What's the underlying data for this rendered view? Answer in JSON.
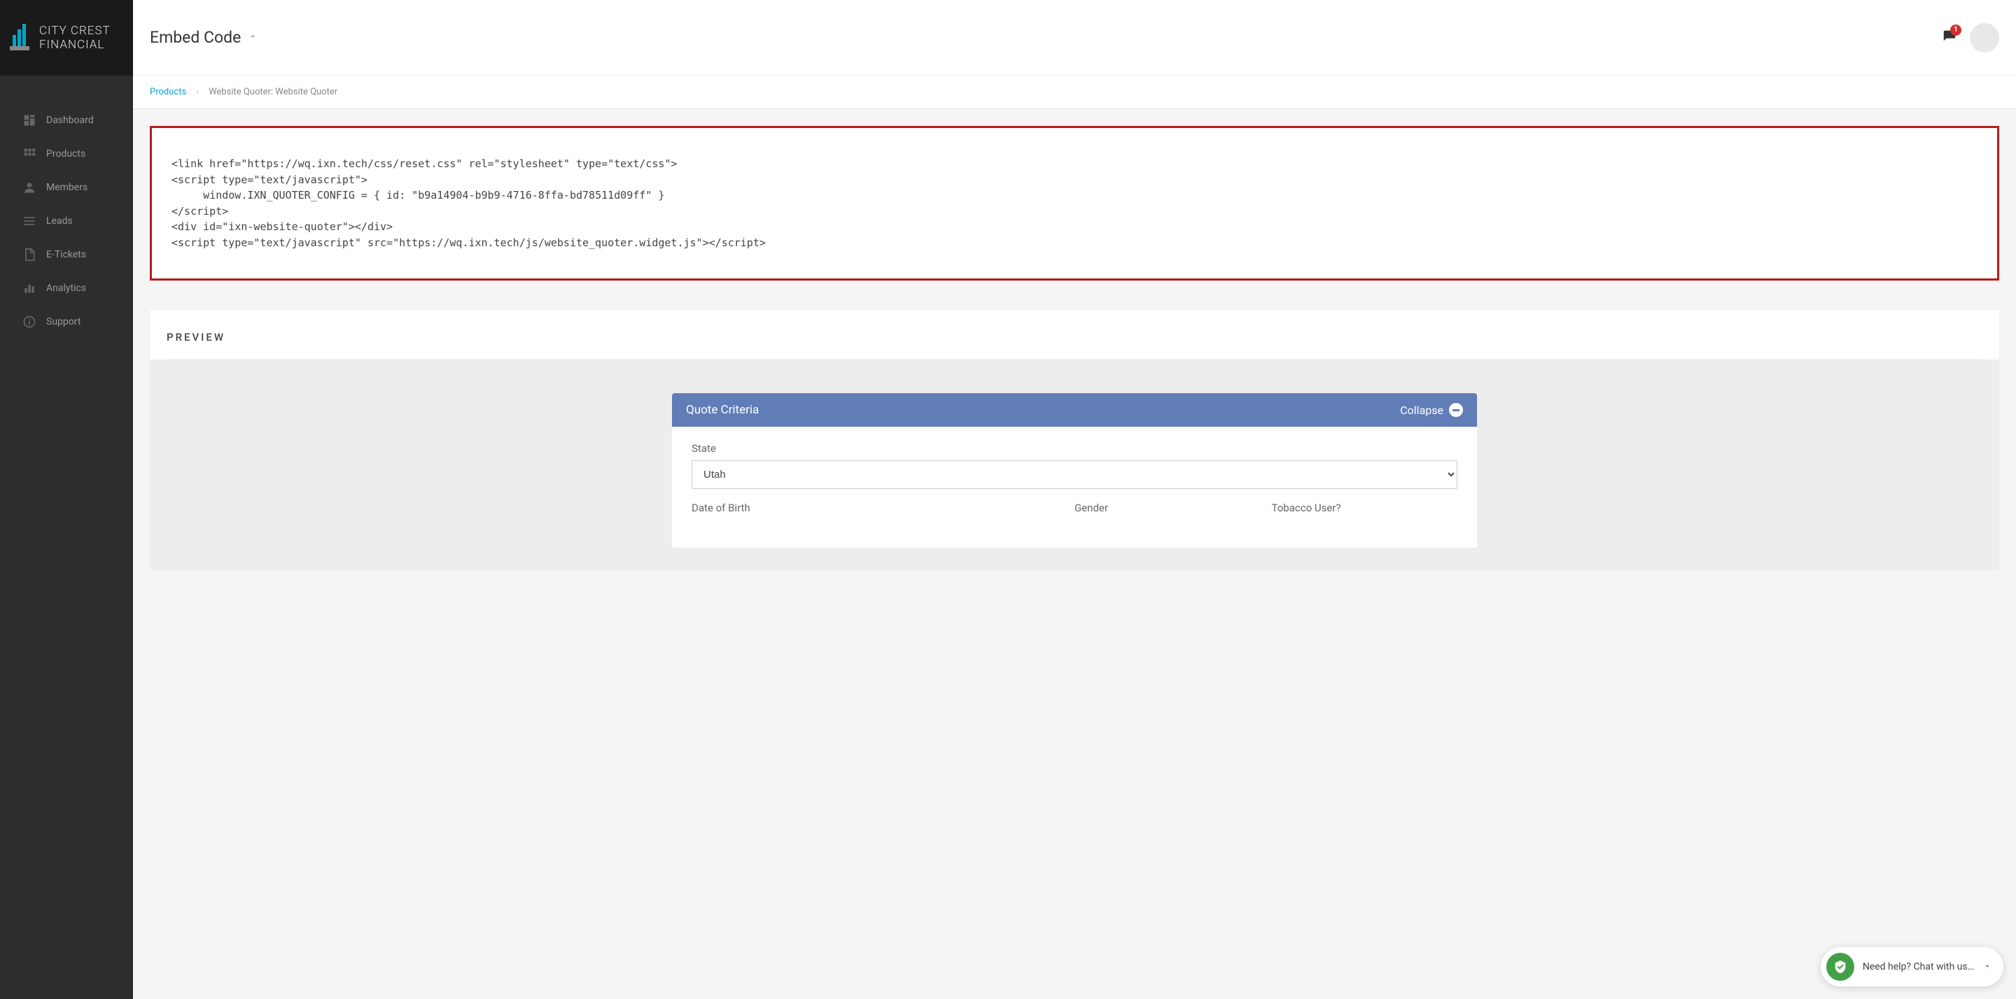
{
  "brand": {
    "line1": "CITY CREST",
    "line2": "FINANCIAL"
  },
  "sidebar": {
    "items": [
      {
        "label": "Dashboard",
        "icon": "dashboard-icon"
      },
      {
        "label": "Products",
        "icon": "products-icon"
      },
      {
        "label": "Members",
        "icon": "members-icon"
      },
      {
        "label": "Leads",
        "icon": "leads-icon"
      },
      {
        "label": "E-Tickets",
        "icon": "etickets-icon"
      },
      {
        "label": "Analytics",
        "icon": "analytics-icon"
      },
      {
        "label": "Support",
        "icon": "support-icon"
      }
    ]
  },
  "header": {
    "title": "Embed Code",
    "notification_count": "1"
  },
  "breadcrumb": {
    "root": "Products",
    "current": "Website Quoter: Website Quoter"
  },
  "embed_code": "<link href=\"https://wq.ixn.tech/css/reset.css\" rel=\"stylesheet\" type=\"text/css\">\n<script type=\"text/javascript\">\n     window.IXN_QUOTER_CONFIG = { id: \"b9a14904-b9b9-4716-8ffa-bd78511d09ff\" }\n</script>\n<div id=\"ixn-website-quoter\"></div>\n<script type=\"text/javascript\" src=\"https://wq.ixn.tech/js/website_quoter.widget.js\"></script>",
  "preview": {
    "section_title": "PREVIEW",
    "panel_title": "Quote Criteria",
    "collapse_label": "Collapse",
    "fields": {
      "state_label": "State",
      "state_value": "Utah",
      "dob_label": "Date of Birth",
      "gender_label": "Gender",
      "tobacco_label": "Tobacco User?"
    }
  },
  "chat": {
    "text": "Need help? Chat with us…"
  }
}
